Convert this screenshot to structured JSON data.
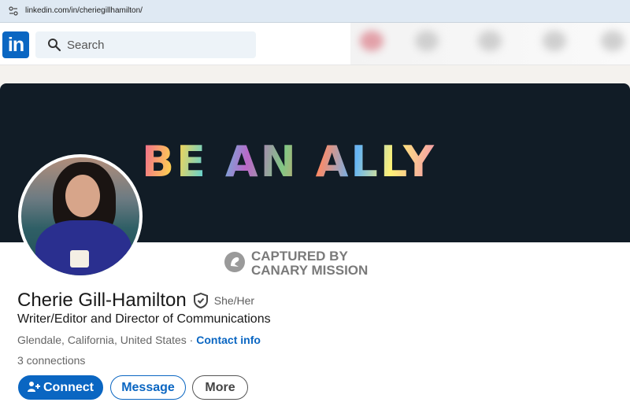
{
  "browser": {
    "url": "linkedin.com/in/cheriegillhamilton/"
  },
  "nav": {
    "logo_text": "in",
    "search_placeholder": "Search"
  },
  "banner": {
    "text": "BE AN ALLY"
  },
  "watermark": {
    "line1": "CAPTURED BY",
    "line2": "CANARY MISSION"
  },
  "profile": {
    "name": "Cherie Gill-Hamilton",
    "pronouns": "She/Her",
    "headline": "Writer/Editor and Director of Communications",
    "location": "Glendale, California, United States",
    "separator": " · ",
    "contact_link": "Contact info",
    "connections": "3 connections"
  },
  "actions": {
    "connect": "Connect",
    "message": "Message",
    "more": "More"
  },
  "colors": {
    "accent": "#0a66c2",
    "banner_bg": "#111c26"
  },
  "icons": [
    "site-info-icon",
    "search-icon",
    "verified-icon",
    "add-person-icon",
    "canary-mission-icon"
  ]
}
